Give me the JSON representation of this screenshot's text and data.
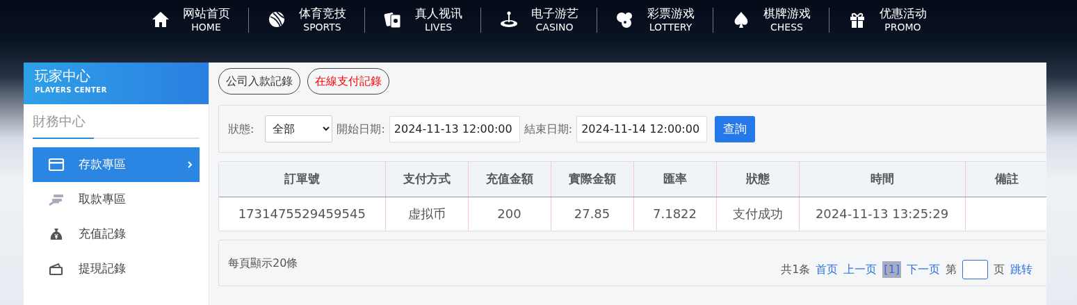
{
  "nav": [
    {
      "kind": "home",
      "zh": "网站首页",
      "en": "HOME"
    },
    {
      "kind": "sports",
      "zh": "体育竞技",
      "en": "SPORTS"
    },
    {
      "kind": "lives",
      "zh": "真人视讯",
      "en": "LIVES"
    },
    {
      "kind": "casino",
      "zh": "电子游艺",
      "en": "CASINO"
    },
    {
      "kind": "lottery",
      "zh": "彩票游戏",
      "en": "LOTTERY"
    },
    {
      "kind": "chess",
      "zh": "棋牌游戏",
      "en": "CHESS"
    },
    {
      "kind": "promo",
      "zh": "优惠活动",
      "en": "PROMO"
    }
  ],
  "players_center": {
    "title": "玩家中心",
    "subtitle": "PLAYERS CENTER"
  },
  "sidebar": {
    "heading": "財務中心",
    "items": [
      {
        "kind": "card",
        "label": "存款專區",
        "selected": true
      },
      {
        "kind": "hand",
        "label": "取款專區",
        "selected": false
      },
      {
        "kind": "bag",
        "label": "充值記錄",
        "selected": false
      },
      {
        "kind": "wallet",
        "label": "提現記錄",
        "selected": false
      }
    ]
  },
  "tabs": [
    {
      "label": "公司入款記錄",
      "selected": false
    },
    {
      "label": "在線支付記錄",
      "selected": true
    }
  ],
  "filter": {
    "status_label": "狀態:",
    "status_value": "全部",
    "start_label": "開始日期:",
    "start_value": "2024-11-13 12:00:00",
    "end_label": "結束日期:",
    "end_value": "2024-11-14 12:00:00",
    "button": "查詢"
  },
  "table": {
    "columns": [
      "訂單號",
      "支付方式",
      "充值金額",
      "實際金額",
      "匯率",
      "狀態",
      "時間",
      "備註"
    ],
    "rows": [
      [
        "1731475529459545",
        "虚拟币",
        "200",
        "27.85",
        "7.1822",
        "支付成功",
        "2024-11-13 13:25:29",
        ""
      ]
    ]
  },
  "pagination": {
    "per_page": "每頁顯示20條",
    "total": "共1条",
    "first": "首页",
    "prev": "上一页",
    "current": "[1]",
    "next": "下一页",
    "page_prefix": "第",
    "page_suffix": "页",
    "jump": "跳转"
  }
}
